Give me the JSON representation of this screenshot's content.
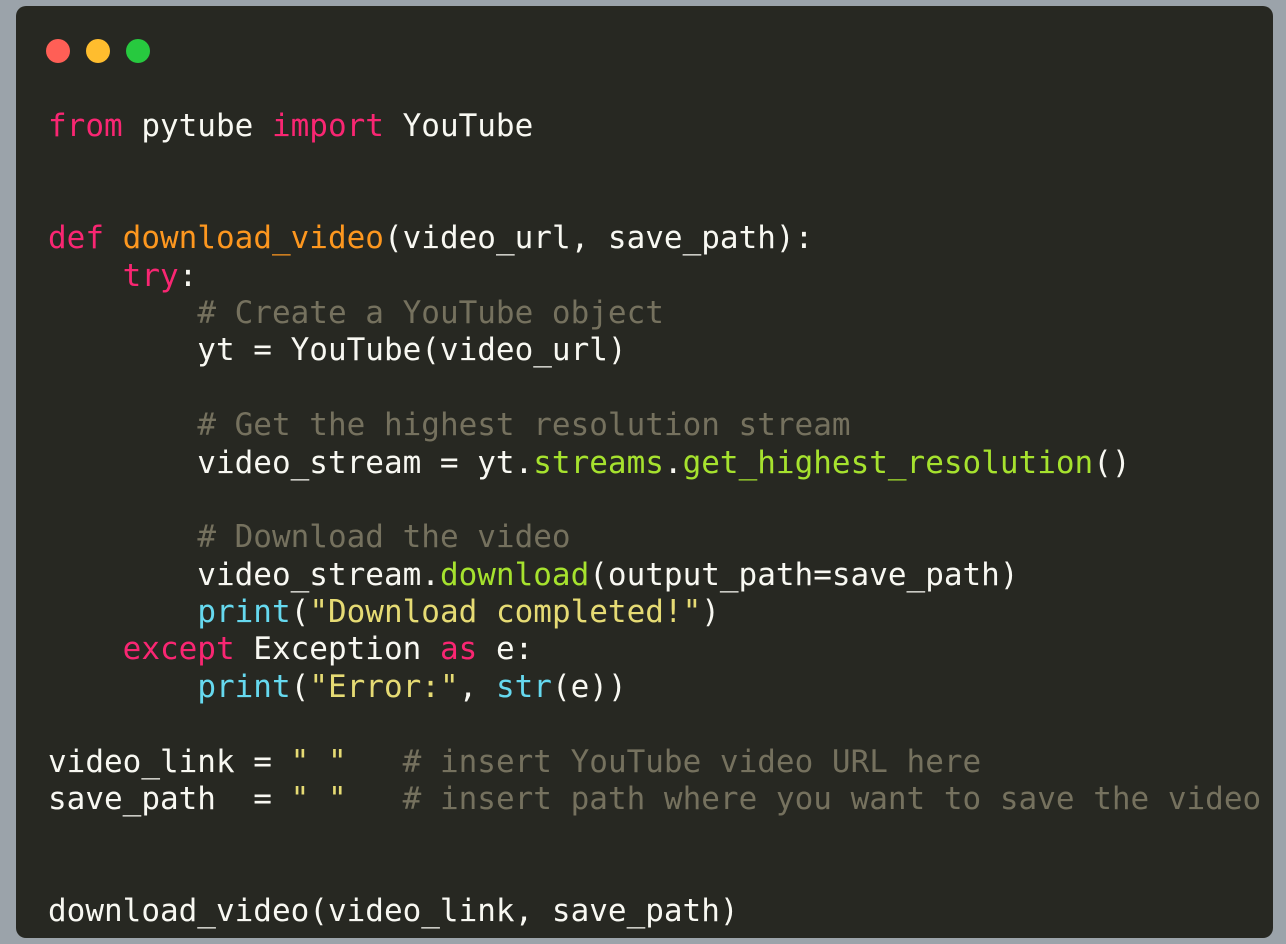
{
  "window": {
    "traffic_lights": [
      {
        "name": "close",
        "color": "#ff5f56"
      },
      {
        "name": "minimize",
        "color": "#ffbd2e"
      },
      {
        "name": "maximize",
        "color": "#27c93f"
      }
    ]
  },
  "theme": {
    "background": "#272822",
    "keyword": "#f92672",
    "function": "#fd971f",
    "comment": "#75715e",
    "string": "#e6db74",
    "builtin": "#66d9ef",
    "method": "#a6e22e",
    "text": "#f8f8f2"
  },
  "code": {
    "lines": [
      [
        {
          "t": "kw",
          "v": "from"
        },
        {
          "t": "txt",
          "v": " pytube "
        },
        {
          "t": "kw",
          "v": "import"
        },
        {
          "t": "txt",
          "v": " YouTube"
        }
      ],
      [],
      [],
      [
        {
          "t": "kw",
          "v": "def"
        },
        {
          "t": "txt",
          "v": " "
        },
        {
          "t": "fn",
          "v": "download_video"
        },
        {
          "t": "txt",
          "v": "(video_url, save_path):"
        }
      ],
      [
        {
          "t": "txt",
          "v": "    "
        },
        {
          "t": "kw",
          "v": "try"
        },
        {
          "t": "txt",
          "v": ":"
        }
      ],
      [
        {
          "t": "txt",
          "v": "        "
        },
        {
          "t": "cm",
          "v": "# Create a YouTube object"
        }
      ],
      [
        {
          "t": "txt",
          "v": "        yt = YouTube(video_url)"
        }
      ],
      [],
      [
        {
          "t": "txt",
          "v": "        "
        },
        {
          "t": "cm",
          "v": "# Get the highest resolution stream"
        }
      ],
      [
        {
          "t": "txt",
          "v": "        video_stream = yt."
        },
        {
          "t": "meth",
          "v": "streams"
        },
        {
          "t": "txt",
          "v": "."
        },
        {
          "t": "meth",
          "v": "get_highest_resolution"
        },
        {
          "t": "txt",
          "v": "()"
        }
      ],
      [],
      [
        {
          "t": "txt",
          "v": "        "
        },
        {
          "t": "cm",
          "v": "# Download the video"
        }
      ],
      [
        {
          "t": "txt",
          "v": "        video_stream."
        },
        {
          "t": "meth",
          "v": "download"
        },
        {
          "t": "txt",
          "v": "(output_path=save_path)"
        }
      ],
      [
        {
          "t": "txt",
          "v": "        "
        },
        {
          "t": "bi",
          "v": "print"
        },
        {
          "t": "txt",
          "v": "("
        },
        {
          "t": "str",
          "v": "\"Download completed!\""
        },
        {
          "t": "txt",
          "v": ")"
        }
      ],
      [
        {
          "t": "txt",
          "v": "    "
        },
        {
          "t": "kw",
          "v": "except"
        },
        {
          "t": "txt",
          "v": " Exception "
        },
        {
          "t": "kw",
          "v": "as"
        },
        {
          "t": "txt",
          "v": " e:"
        }
      ],
      [
        {
          "t": "txt",
          "v": "        "
        },
        {
          "t": "bi",
          "v": "print"
        },
        {
          "t": "txt",
          "v": "("
        },
        {
          "t": "str",
          "v": "\"Error:\""
        },
        {
          "t": "txt",
          "v": ", "
        },
        {
          "t": "bi",
          "v": "str"
        },
        {
          "t": "txt",
          "v": "(e))"
        }
      ],
      [],
      [
        {
          "t": "txt",
          "v": "video_link = "
        },
        {
          "t": "str",
          "v": "\" \""
        },
        {
          "t": "txt",
          "v": "   "
        },
        {
          "t": "cm",
          "v": "# insert YouTube video URL here"
        }
      ],
      [
        {
          "t": "txt",
          "v": "save_path  = "
        },
        {
          "t": "str",
          "v": "\" \""
        },
        {
          "t": "txt",
          "v": "   "
        },
        {
          "t": "cm",
          "v": "# insert path where you want to save the video"
        }
      ],
      [],
      [],
      [
        {
          "t": "txt",
          "v": "download_video(video_link, save_path)"
        }
      ]
    ]
  }
}
